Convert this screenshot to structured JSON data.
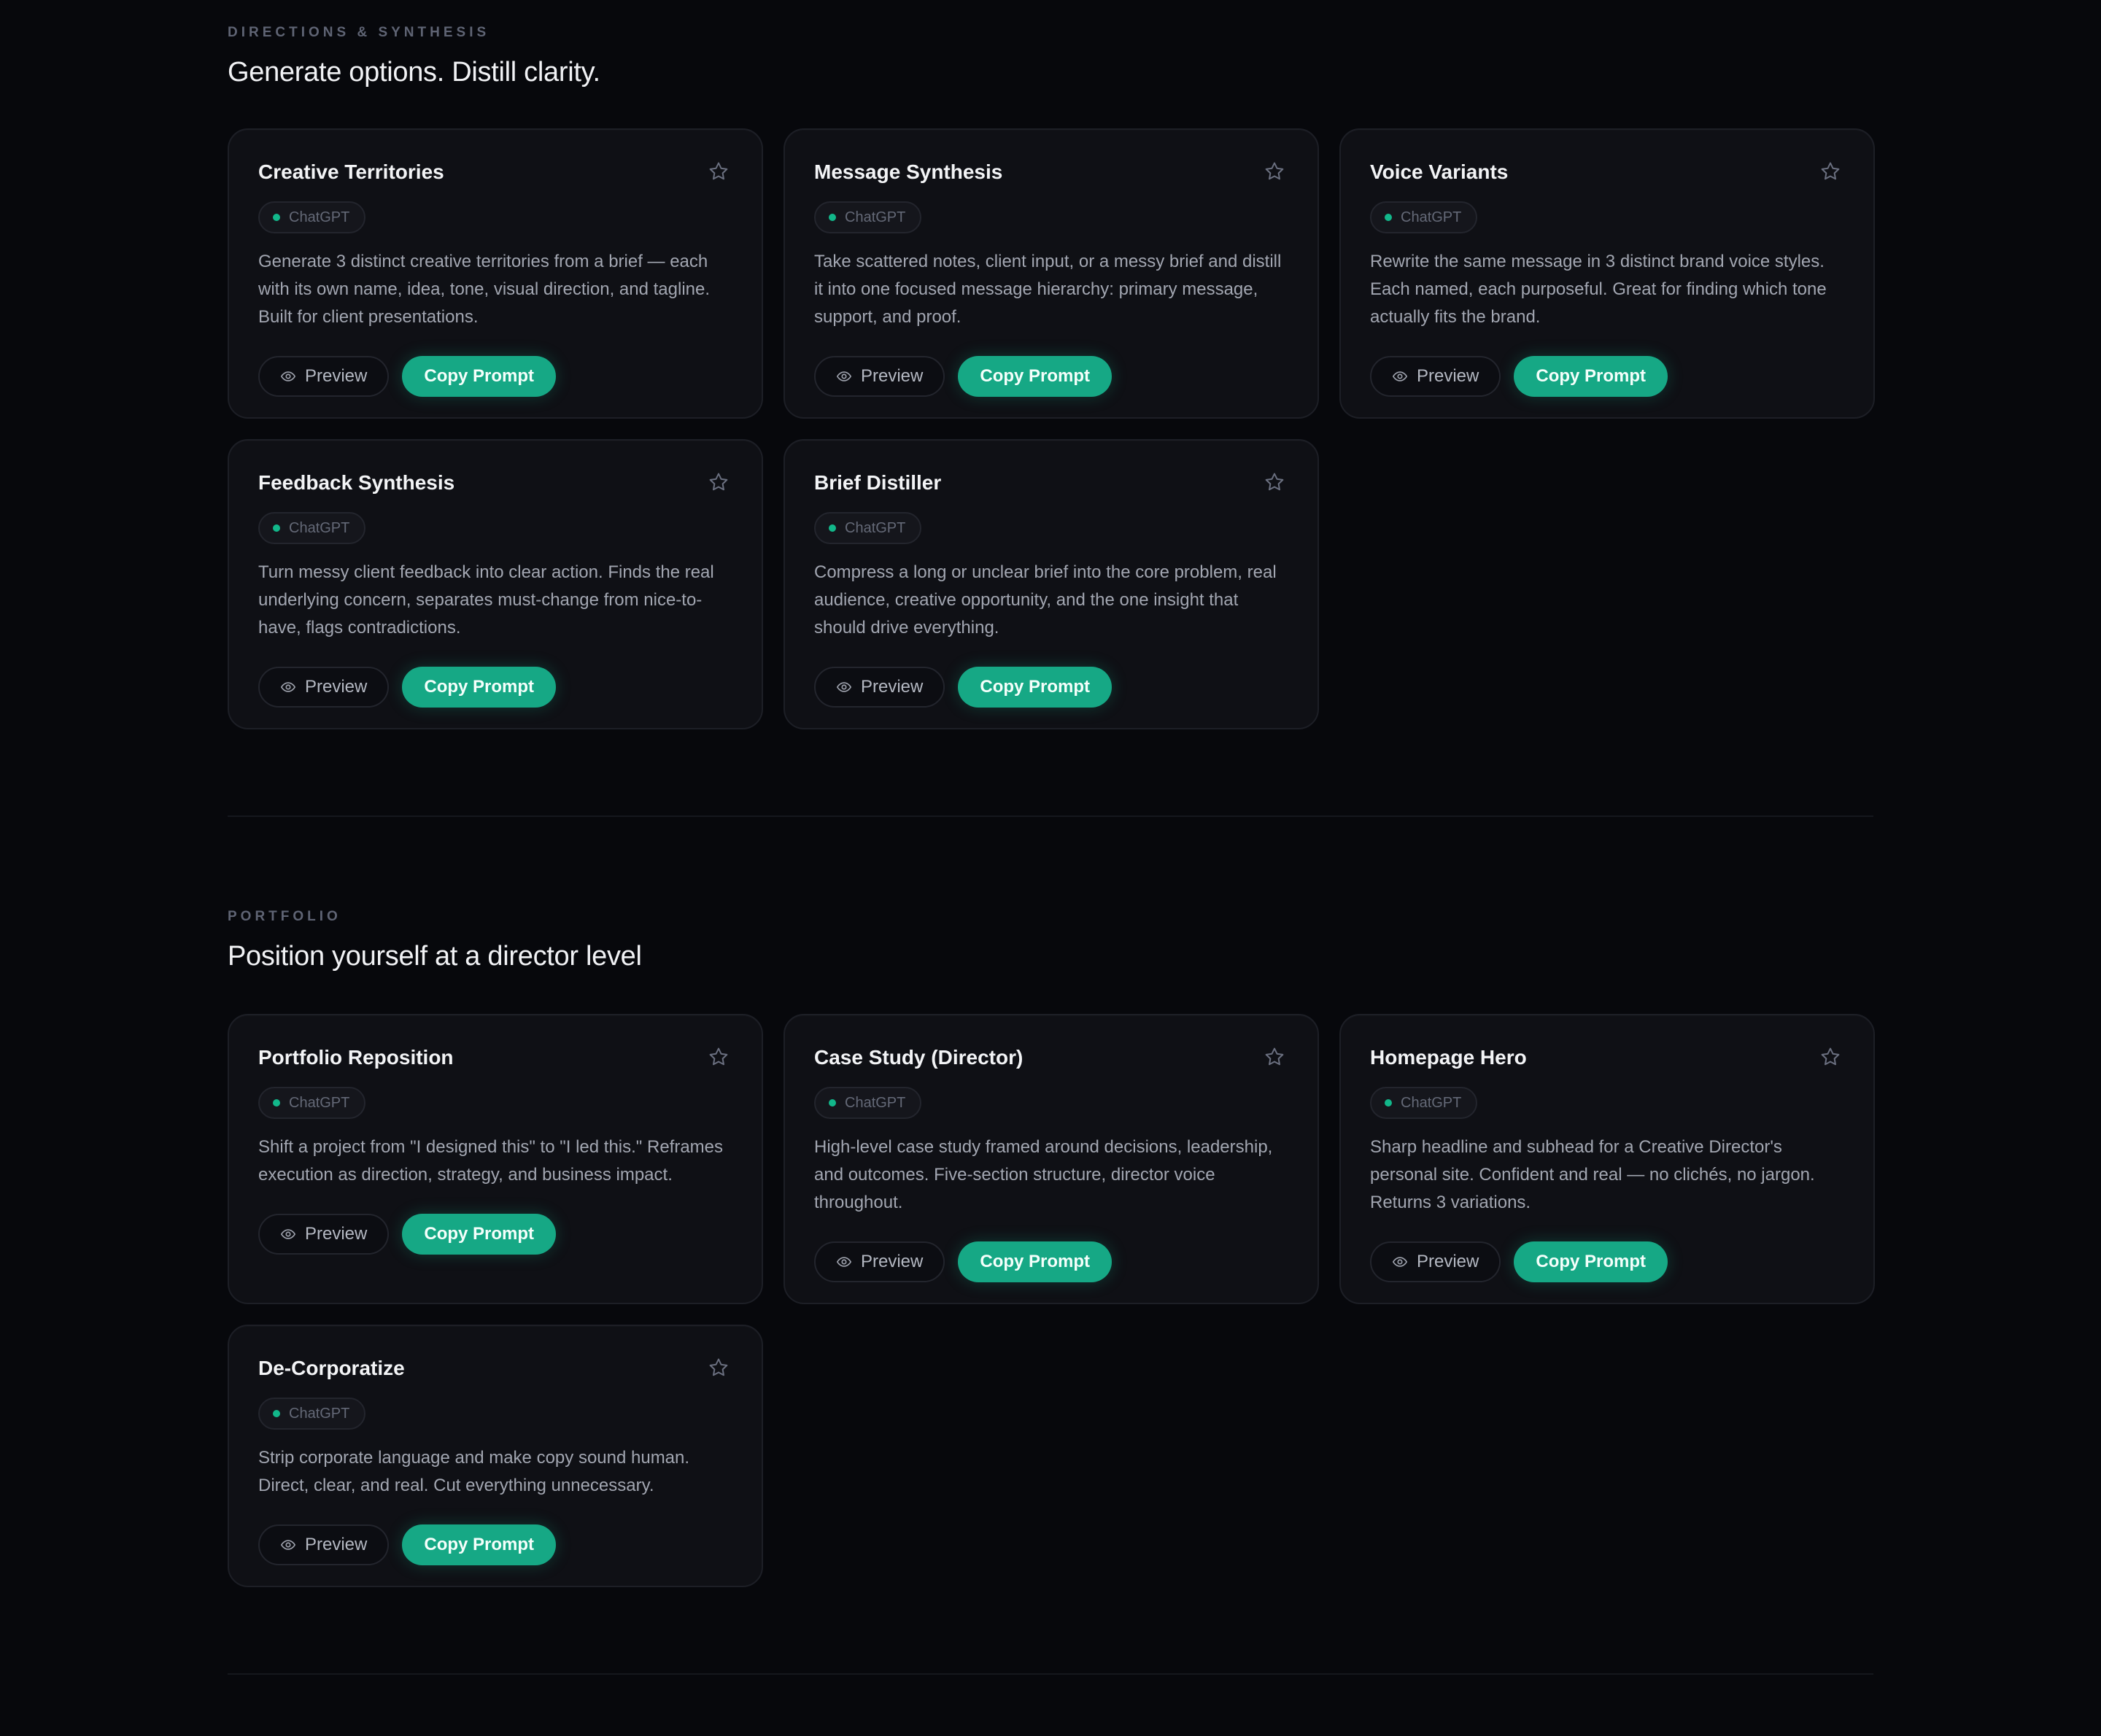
{
  "sections": [
    {
      "eyebrow": "DIRECTIONS & SYNTHESIS",
      "heading": "Generate options. Distill clarity.",
      "cards": [
        {
          "title": "Creative Territories",
          "badge": "ChatGPT",
          "description": "Generate 3 distinct creative territories from a brief — each with its own name, idea, tone, visual direction, and tagline. Built for client presentations.",
          "preview_label": "Preview",
          "copy_label": "Copy Prompt"
        },
        {
          "title": "Message Synthesis",
          "badge": "ChatGPT",
          "description": "Take scattered notes, client input, or a messy brief and distill it into one focused message hierarchy: primary message, support, and proof.",
          "preview_label": "Preview",
          "copy_label": "Copy Prompt"
        },
        {
          "title": "Voice Variants",
          "badge": "ChatGPT",
          "description": "Rewrite the same message in 3 distinct brand voice styles. Each named, each purposeful. Great for finding which tone actually fits the brand.",
          "preview_label": "Preview",
          "copy_label": "Copy Prompt"
        },
        {
          "title": "Feedback Synthesis",
          "badge": "ChatGPT",
          "description": "Turn messy client feedback into clear action. Finds the real underlying concern, separates must-change from nice-to-have, flags contradictions.",
          "preview_label": "Preview",
          "copy_label": "Copy Prompt"
        },
        {
          "title": "Brief Distiller",
          "badge": "ChatGPT",
          "description": "Compress a long or unclear brief into the core problem, real audience, creative opportunity, and the one insight that should drive everything.",
          "preview_label": "Preview",
          "copy_label": "Copy Prompt"
        }
      ]
    },
    {
      "eyebrow": "PORTFOLIO",
      "heading": "Position yourself at a director level",
      "cards": [
        {
          "title": "Portfolio Reposition",
          "badge": "ChatGPT",
          "description": "Shift a project from \"I designed this\" to \"I led this.\" Reframes execution as direction, strategy, and business impact.",
          "preview_label": "Preview",
          "copy_label": "Copy Prompt"
        },
        {
          "title": "Case Study (Director)",
          "badge": "ChatGPT",
          "description": "High-level case study framed around decisions, leadership, and outcomes. Five-section structure, director voice throughout.",
          "preview_label": "Preview",
          "copy_label": "Copy Prompt"
        },
        {
          "title": "Homepage Hero",
          "badge": "ChatGPT",
          "description": "Sharp headline and subhead for a Creative Director's personal site. Confident and real — no clichés, no jargon. Returns 3 variations.",
          "preview_label": "Preview",
          "copy_label": "Copy Prompt"
        },
        {
          "title": "De-Corporatize",
          "badge": "ChatGPT",
          "description": "Strip corporate language and make copy sound human. Direct, clear, and real. Cut everything unnecessary.",
          "preview_label": "Preview",
          "copy_label": "Copy Prompt"
        }
      ]
    }
  ],
  "icons": {
    "favorite": "star-outline-icon",
    "preview": "eye-icon",
    "badge_dot": "status-dot"
  },
  "colors": {
    "background": "#07080c",
    "card": "#0f1015",
    "accent": "#16a885",
    "accent_dot": "#12b78a"
  }
}
